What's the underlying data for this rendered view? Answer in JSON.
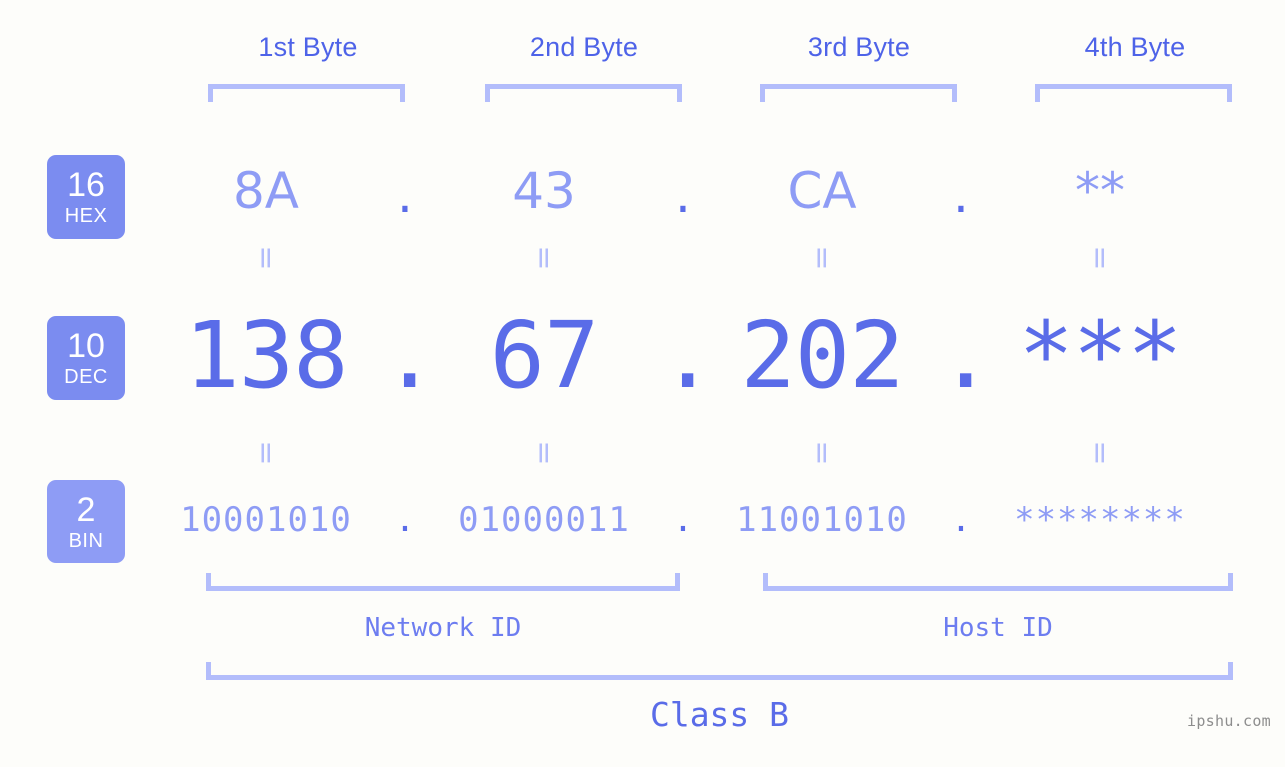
{
  "background_color": "#fdfdfa",
  "accent_colors": {
    "strong_blue": "#5a6ce8",
    "light_blue": "#8e9cf5",
    "pale_blue": "#b3bdfb",
    "badge_blue": "#7b8cf0",
    "badge_blue_light": "#8e9cf5",
    "watermark_gray": "#8d8d8d"
  },
  "byte_headers": [
    {
      "label": "1st Byte"
    },
    {
      "label": "2nd Byte"
    },
    {
      "label": "3rd Byte"
    },
    {
      "label": "4th Byte"
    }
  ],
  "bases": [
    {
      "number": "16",
      "name": "HEX"
    },
    {
      "number": "10",
      "name": "DEC"
    },
    {
      "number": "2",
      "name": "BIN"
    }
  ],
  "separator": ".",
  "equals_mark": "=",
  "rows": {
    "hex": {
      "values": [
        "8A",
        "43",
        "CA",
        "**"
      ]
    },
    "dec": {
      "values": [
        "138",
        "67",
        "202",
        "***"
      ]
    },
    "bin": {
      "values": [
        "10001010",
        "01000011",
        "11001010",
        "********"
      ]
    }
  },
  "sections": [
    {
      "label": "Network ID"
    },
    {
      "label": "Host ID"
    }
  ],
  "class": {
    "label": "Class B"
  },
  "watermark": {
    "text": "ipshu.com"
  }
}
